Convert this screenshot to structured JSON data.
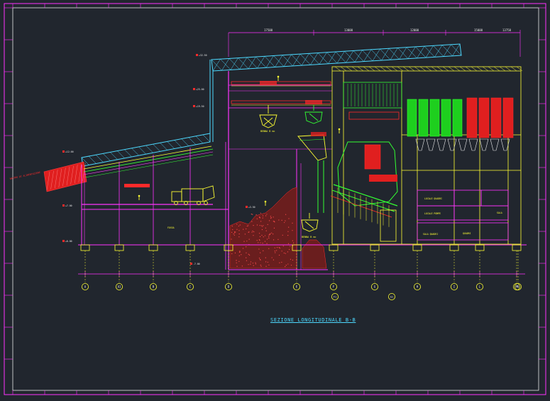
{
  "title": "SEZIONE LONGITUDINALE B-B",
  "labels": {
    "conveyor_tag": "NASTRO DI ALIMENTAZIONE",
    "crane_left": "BENNA B mc",
    "crane_right": "BENNA B mc",
    "grab_lower": "BENNA B mc",
    "room_a": "LOCALE POMPE",
    "room_b": "SALA QUADRI",
    "room_c": "LOCALE QUADRI",
    "room_d": "QUADRI",
    "room_e": "SALA",
    "pit_tag": "FOSSA"
  },
  "dims_top": [
    "17500",
    "13000",
    "12000",
    "15000",
    "13750"
  ],
  "grid_labels": [
    "A",
    "A1",
    "B",
    "C",
    "D",
    "E",
    "F",
    "G",
    "H",
    "I",
    "L",
    "M",
    "N"
  ],
  "grid_sub_labels": [
    "F1",
    "G1"
  ],
  "elev_labels": [
    "+32.50",
    "+25.00",
    "+19.50",
    "+12.00",
    "+7.00",
    "+3.50",
    "+0.00",
    "-7.00"
  ],
  "colors": {
    "background": "#21262e",
    "cyan": "#4dd9ff",
    "yellow": "#ffff33",
    "magenta": "#ff33ff",
    "red": "#ff2a2a",
    "green": "#33ff33",
    "white": "#e8e8e8",
    "border": "#ff33ff"
  }
}
